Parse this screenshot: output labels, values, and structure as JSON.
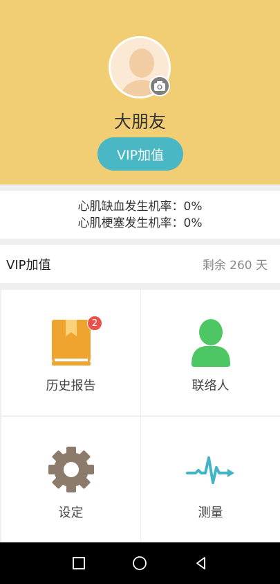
{
  "status_bar": {
    "left": "",
    "right": ""
  },
  "profile": {
    "name": "大朋友",
    "vip_button_label": "VIP加值"
  },
  "risk": {
    "ischemia": "心肌缺血发生机率：0%",
    "infarction": "心肌梗塞发生机率：0%"
  },
  "vip": {
    "label": "VIP加值",
    "remaining": "剩余 260 天"
  },
  "menu": {
    "history": {
      "label": "历史报告",
      "badge": "2",
      "icon": "report-book-icon"
    },
    "contacts": {
      "label": "联络人",
      "icon": "person-icon"
    },
    "settings": {
      "label": "设定",
      "icon": "gear-icon"
    },
    "measure": {
      "label": "测量",
      "icon": "heartbeat-icon"
    }
  },
  "colors": {
    "header": "#f1cd73",
    "vip_button": "#4ab8c4",
    "report_icon": "#f0a430",
    "contact_icon": "#4dc764",
    "gear_icon": "#8c7a6b",
    "pulse_icon": "#43b4c6",
    "badge": "#e8524a"
  }
}
